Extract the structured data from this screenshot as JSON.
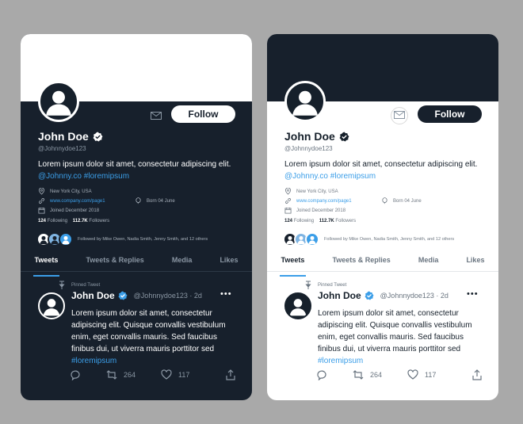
{
  "profiles": [
    {
      "theme": "dark",
      "name": "John Doe",
      "handle": "@Johnnydoe123",
      "follow_label": "Follow",
      "bio_text": "Lorem ipsum dolor sit amet, consectetur adipiscing elit.",
      "bio_link": "@Johnny.co",
      "bio_hashtag": "#loremipsum",
      "location": "New York City, USA",
      "website": "www.company.com/page1",
      "birthday": "Born 04 June",
      "joined": "Joined December 2018",
      "following_count": "124",
      "following_label": "Following",
      "followers_count": "112.7K",
      "followers_label": "Followers",
      "followed_by": "Followed by Mike Owen, Nadia Smith, Jenny Smith, and 12 others",
      "tabs": [
        "Tweets",
        "Tweets & Replies",
        "Media",
        "Likes"
      ],
      "pinned_label": "Pinned Tweet",
      "tweet": {
        "name": "John Doe",
        "handle_date": "@Johnnydoe123 · 2d",
        "text": "Lorem ipsum dolor sit amet, consectetur adipiscing elit. Quisque convallis vestibulum enim, eget convallis mauris. Sed faucibus finibus dui, ut viverra mauris porttitor sed",
        "hashtag": "#loremipsum",
        "retweets": "264",
        "likes": "117",
        "more": "•••"
      }
    },
    {
      "theme": "light",
      "name": "John Doe",
      "handle": "@Johnnydoe123",
      "follow_label": "Follow",
      "bio_text": "Lorem ipsum dolor sit amet, consectetur adipiscing elit.",
      "bio_link": "@Johnny.co",
      "bio_hashtag": "#loremipsum",
      "location": "New York City, USA",
      "website": "www.company.com/page1",
      "birthday": "Born 04 June",
      "joined": "Joined December 2018",
      "following_count": "124",
      "following_label": "Following",
      "followers_count": "112.7K",
      "followers_label": "Followers",
      "followed_by": "Followed by Mike Owen, Nadia Smith, Jenny Smith, and 12 others",
      "tabs": [
        "Tweets",
        "Tweets & Replies",
        "Media",
        "Likes"
      ],
      "pinned_label": "Pinned Tweet",
      "tweet": {
        "name": "John Doe",
        "handle_date": "@Johnnydoe123 · 2d",
        "text": "Lorem ipsum dolor sit amet, consectetur adipiscing elit. Quisque convallis vestibulum enim, eget convallis mauris. Sed faucibus finibus dui, ut viverra mauris porttitor sed",
        "hashtag": "#loremipsum",
        "retweets": "264",
        "likes": "117",
        "more": "•••"
      }
    }
  ],
  "colors": {
    "dark_bg": "#17202c",
    "light_bg": "#ffffff",
    "accent": "#3b9ee8",
    "page_bg": "#a9a9a9"
  }
}
